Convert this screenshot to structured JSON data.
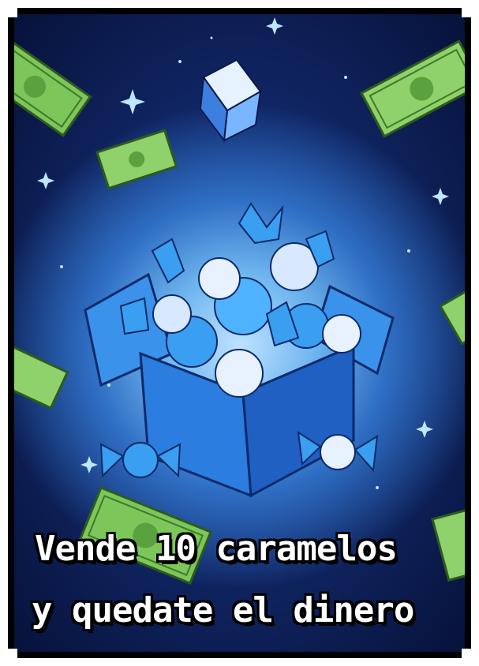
{
  "caption": {
    "line1": "Vende 10 caramelos",
    "line2": "y quedate el dinero"
  },
  "colors": {
    "background_space": "#0f2460",
    "glow": "#bfe2ff",
    "box_blue": "#2b7de0",
    "candy_blue": "#3a9ff0",
    "banknote_green": "#8fd16a",
    "border": "#000000",
    "text": "#ffffff"
  },
  "icons": [
    "gift-box-icon",
    "wrapped-candy-icon",
    "banknote-icon",
    "ice-cube-icon",
    "sparkle-icon"
  ]
}
